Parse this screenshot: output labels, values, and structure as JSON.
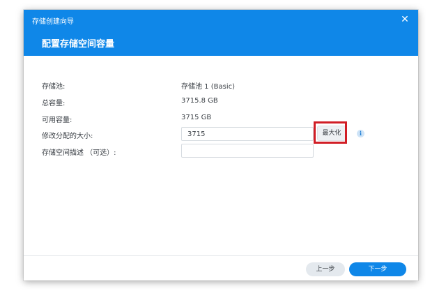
{
  "dialog": {
    "wizard_title": "存储创建向导",
    "close_glyph": "✕",
    "step_title": "配置存储空间容量"
  },
  "form": {
    "pool_label": "存储池:",
    "pool_value": "存储池 1 (Basic)",
    "total_label": "总容量:",
    "total_value": "3715.8 GB",
    "available_label": "可用容量:",
    "available_value": "3715 GB",
    "size_label": "修改分配的大小:",
    "size_value": "3715",
    "max_label": "最大化",
    "info_glyph": "i",
    "desc_label": "存储空间描述 （可选）:",
    "desc_value": ""
  },
  "footer": {
    "prev_label": "上一步",
    "next_label": "下一步"
  },
  "colors": {
    "accent": "#0f87e8",
    "highlight": "#d11e26"
  },
  "icons": {
    "close": "close-icon",
    "info": "info-icon"
  }
}
